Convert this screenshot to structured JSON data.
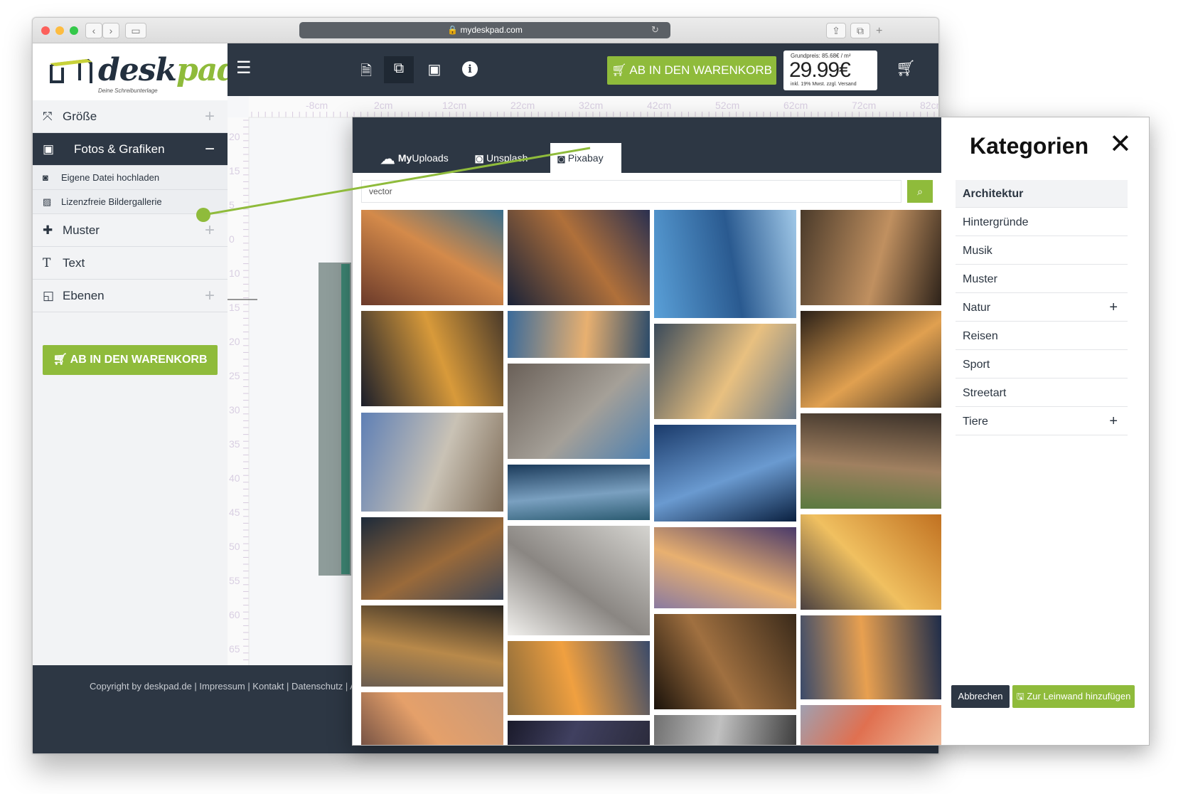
{
  "browser": {
    "url": "mydeskpad.com"
  },
  "logo": {
    "brand": "deskpad",
    "tagline": "Deine Schreibunterlage"
  },
  "sidebar": {
    "items": [
      {
        "label": "Größe",
        "icon": "resize-icon",
        "toggle": "+"
      },
      {
        "label": "Fotos & Grafiken",
        "icon": "image-icon",
        "toggle": "−"
      },
      {
        "label": "Muster",
        "icon": "puzzle-icon",
        "toggle": "+"
      },
      {
        "label": "Text",
        "icon": "text-icon",
        "toggle": ""
      },
      {
        "label": "Ebenen",
        "icon": "layers-icon",
        "toggle": "+"
      }
    ],
    "subitems": [
      {
        "label": "Eigene Datei hochladen",
        "icon": "camera-icon"
      },
      {
        "label": "Lizenzfreie Bildergallerie",
        "icon": "gallery-icon"
      }
    ],
    "cart_button": "AB IN DEN WARENKORB"
  },
  "topbar": {
    "cart_button": "AB IN DEN WARENKORB",
    "price_base": "Grundpreis: 85.68€ / m²",
    "price": "29.99€",
    "price_note": "inkl. 19% Mwst. zzgl. Versand"
  },
  "ruler": {
    "h_labels": [
      "-8cm",
      "2cm",
      "12cm",
      "22cm",
      "32cm",
      "42cm",
      "52cm",
      "62cm",
      "72cm",
      "82cm"
    ],
    "v_labels": [
      "20",
      "15",
      "5",
      "0",
      "10",
      "15",
      "20",
      "25",
      "30",
      "35",
      "40",
      "45",
      "50",
      "55",
      "60",
      "65"
    ]
  },
  "footer": {
    "text": "Copyright by deskpad.de | Impressum | Kontakt | Datenschutz | A"
  },
  "modal": {
    "tabs": [
      {
        "label_bold": "My",
        "label": "Uploads",
        "icon": "cloud-upload-icon"
      },
      {
        "label_bold": "",
        "label": "Unsplash",
        "icon": "camera-icon"
      },
      {
        "label_bold": "",
        "label": "Pixabay",
        "icon": "pixabay-camera-icon"
      }
    ],
    "active_tab": "Pixabay",
    "search_value": "vector",
    "categories_title": "Kategorien",
    "categories": [
      {
        "label": "Architektur",
        "expandable": false,
        "active": true
      },
      {
        "label": "Hintergründe",
        "expandable": false,
        "active": false
      },
      {
        "label": "Musik",
        "expandable": false,
        "active": false
      },
      {
        "label": "Muster",
        "expandable": false,
        "active": false
      },
      {
        "label": "Natur",
        "expandable": true,
        "active": false
      },
      {
        "label": "Reisen",
        "expandable": false,
        "active": false
      },
      {
        "label": "Sport",
        "expandable": false,
        "active": false
      },
      {
        "label": "Streetart",
        "expandable": false,
        "active": false
      },
      {
        "label": "Tiere",
        "expandable": true,
        "active": false
      }
    ],
    "cancel_button": "Abbrechen",
    "add_button": "Zur Leinwand hinzufügen"
  },
  "colors": {
    "accent": "#8fbb3b",
    "dark": "#2d3744"
  }
}
